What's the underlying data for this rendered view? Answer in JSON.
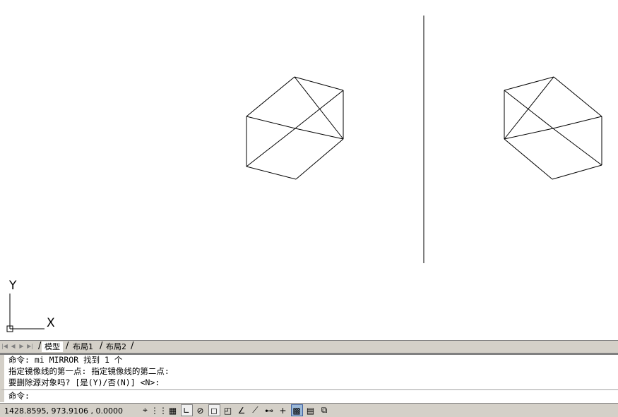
{
  "ucs": {
    "y_label": "Y",
    "x_label": "X"
  },
  "tabs": {
    "nav_first": "|◀",
    "nav_prev": "◀",
    "nav_next": "▶",
    "nav_last": "▶|",
    "items": [
      {
        "label": "模型"
      },
      {
        "label": "布局1"
      },
      {
        "label": "布局2"
      }
    ]
  },
  "command_history": [
    "命令: mi MIRROR 找到 1 个",
    "指定镜像线的第一点: 指定镜像线的第二点:",
    "要删除源对象吗? [是(Y)/否(N)] <N>:"
  ],
  "command_prompt": "命令:",
  "status": {
    "coordinates": "1428.8595, 973.9106 , 0.0000",
    "buttons": [
      {
        "icon": "infer-constraints-icon",
        "glyph": "⌖"
      },
      {
        "icon": "snap-mode-icon",
        "glyph": "⋮⋮"
      },
      {
        "icon": "grid-display-icon",
        "glyph": "▦"
      },
      {
        "icon": "ortho-mode-icon",
        "glyph": "∟"
      },
      {
        "icon": "polar-tracking-icon",
        "glyph": "⊘"
      },
      {
        "icon": "object-snap-icon",
        "glyph": "◻"
      },
      {
        "icon": "3d-object-snap-icon",
        "glyph": "◰"
      },
      {
        "icon": "object-snap-tracking-icon",
        "glyph": "∠"
      },
      {
        "icon": "dynamic-ucs-icon",
        "glyph": "⟋"
      },
      {
        "icon": "dynamic-input-icon",
        "glyph": "⊷"
      },
      {
        "icon": "lineweight-icon",
        "glyph": "+"
      },
      {
        "icon": "transparency-icon",
        "glyph": "▩"
      },
      {
        "icon": "quick-properties-icon",
        "glyph": "▤"
      },
      {
        "icon": "selection-cycling-icon",
        "glyph": "⧉"
      }
    ]
  }
}
